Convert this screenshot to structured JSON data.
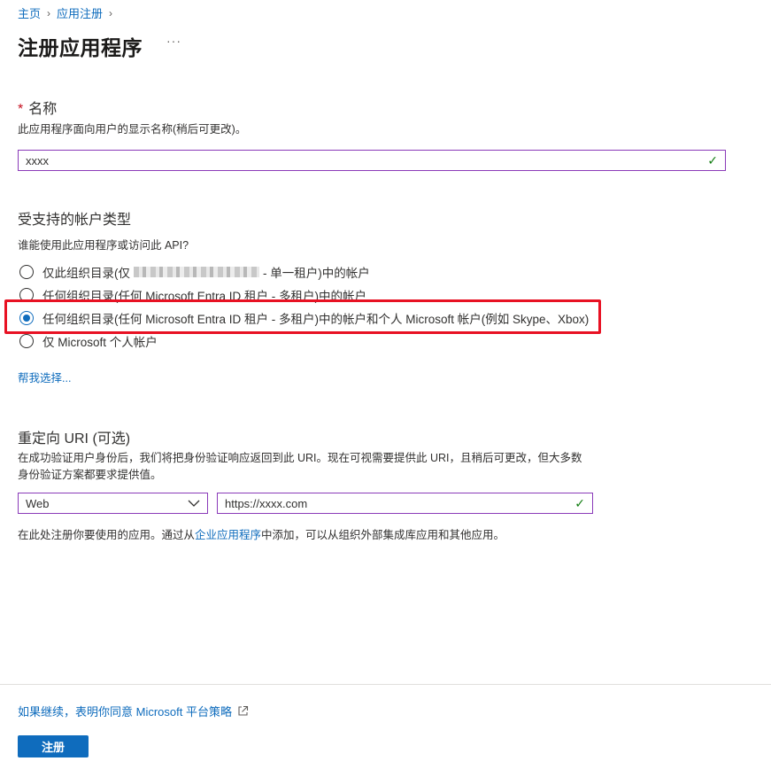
{
  "breadcrumb": {
    "home": "主页",
    "app_registrations": "应用注册"
  },
  "page": {
    "title": "注册应用程序",
    "more": "···"
  },
  "name_section": {
    "required_mark": "*",
    "title": "名称",
    "description": "此应用程序面向用户的显示名称(稍后可更改)。",
    "value": "xxxx"
  },
  "account_types": {
    "title": "受支持的帐户类型",
    "question": "谁能使用此应用程序或访问此 API?",
    "options": [
      {
        "label_prefix": "仅此组织目录(仅",
        "label_suffix": "- 单一租户)中的帐户",
        "selected": false
      },
      {
        "label": "任何组织目录(任何 Microsoft Entra ID 租户 - 多租户)中的帐户",
        "selected": false
      },
      {
        "label": "任何组织目录(任何 Microsoft Entra ID 租户 - 多租户)中的帐户和个人 Microsoft 帐户(例如 Skype、Xbox)",
        "selected": true
      },
      {
        "label": "仅 Microsoft 个人帐户",
        "selected": false
      }
    ],
    "help_link": "帮我选择..."
  },
  "redirect": {
    "title": "重定向 URI (可选)",
    "description_line1": "在成功验证用户身份后，我们将把身份验证响应返回到此 URI。现在可视需要提供此 URI，且稍后可更改，但大多数",
    "description_line2": "身份验证方案都要求提供值。",
    "platform": "Web",
    "uri": "https://xxxx.com",
    "note_before": "在此处注册你要使用的应用。通过从",
    "note_link": "企业应用程序",
    "note_after": "中添加，可以从组织外部集成库应用和其他应用。"
  },
  "footer": {
    "policy_link": "如果继续，表明你同意 Microsoft 平台策略",
    "register_button": "注册"
  },
  "colors": {
    "accent": "#0f6cbd",
    "highlight": "#e81123",
    "input_border": "#8a3ab9",
    "valid": "#107c10"
  },
  "icons": {
    "chevron": "chevron-right-icon",
    "check": "checkmark-icon",
    "dropdown": "chevron-down-icon",
    "external": "open-in-new-icon"
  }
}
